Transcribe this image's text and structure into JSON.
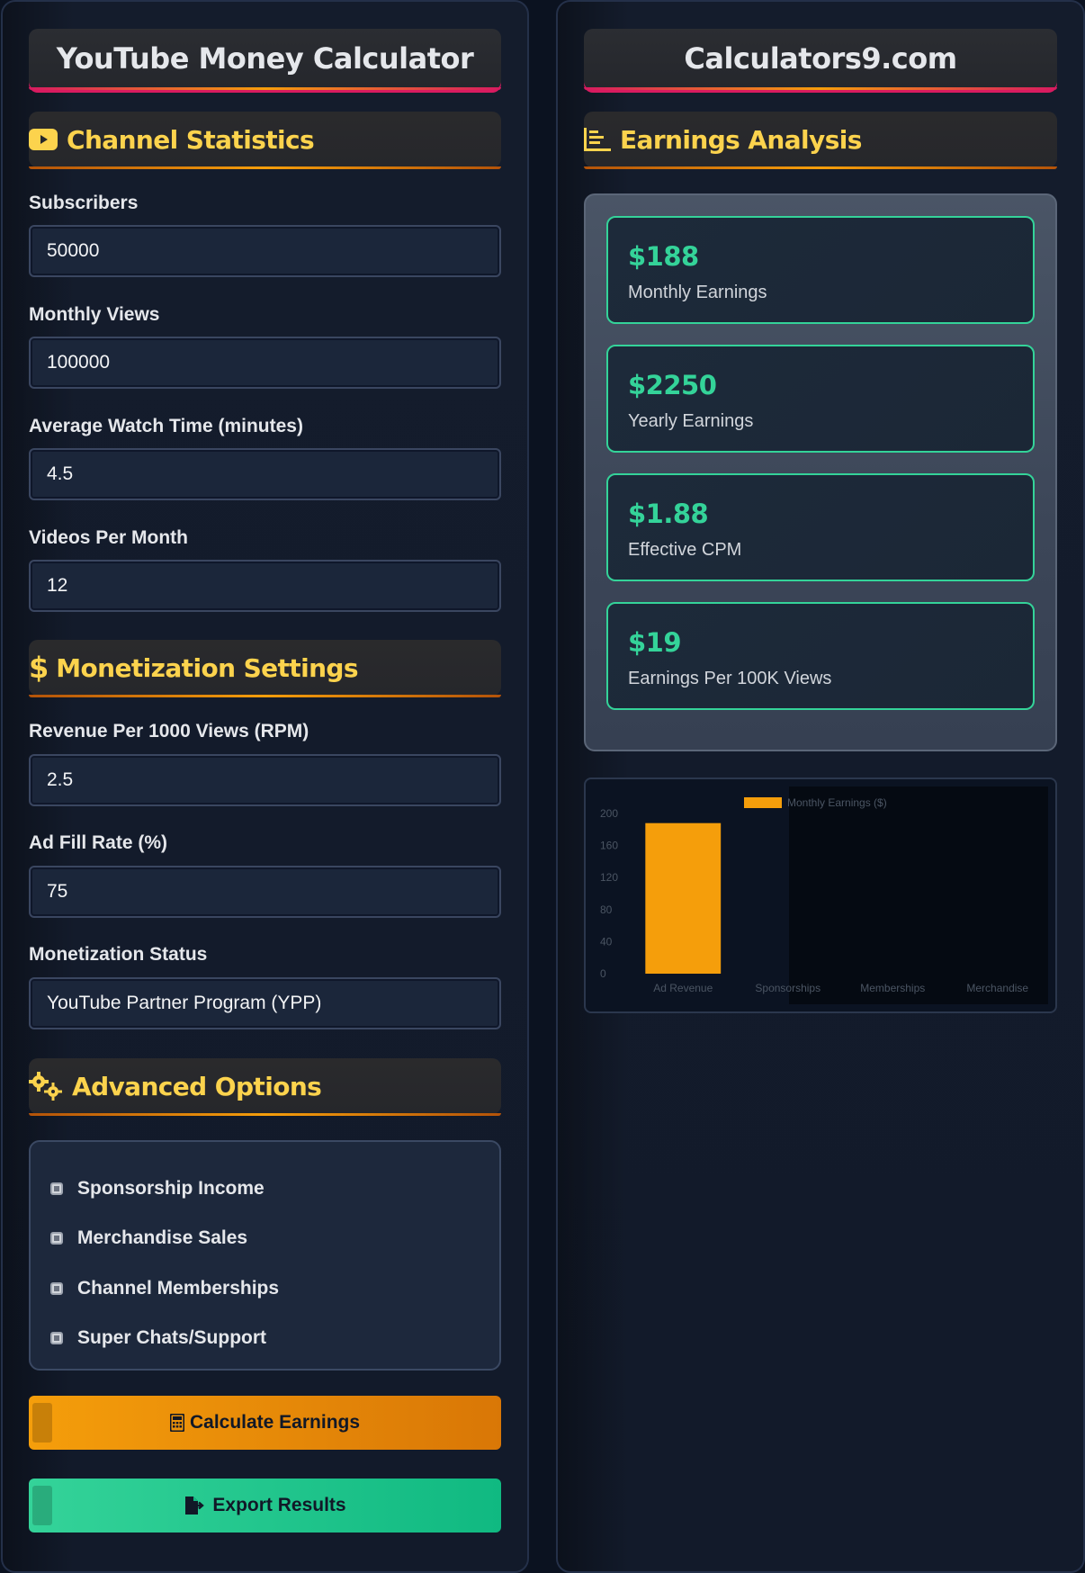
{
  "left_panel": {
    "title": "YouTube Money Calculator",
    "sections": {
      "channel": {
        "title": "Channel Statistics",
        "icon": "youtube-icon"
      },
      "monetization": {
        "title": "Monetization Settings",
        "icon": "dollar-icon"
      },
      "advanced": {
        "title": "Advanced Options",
        "icon": "gears-icon"
      }
    },
    "fields": {
      "subscribers": {
        "label": "Subscribers",
        "value": "50000"
      },
      "monthly_views": {
        "label": "Monthly Views",
        "value": "100000"
      },
      "watch_time": {
        "label": "Average Watch Time (minutes)",
        "value": "4.5"
      },
      "videos_per_month": {
        "label": "Videos Per Month",
        "value": "12"
      },
      "rpm": {
        "label": "Revenue Per 1000 Views (RPM)",
        "value": "2.5"
      },
      "fill_rate": {
        "label": "Ad Fill Rate (%)",
        "value": "75"
      },
      "status": {
        "label": "Monetization Status",
        "value": "YouTube Partner Program (YPP)"
      }
    },
    "options": [
      {
        "label": "Sponsorship Income",
        "checked": false
      },
      {
        "label": "Merchandise Sales",
        "checked": false
      },
      {
        "label": "Channel Memberships",
        "checked": false
      },
      {
        "label": "Super Chats/Support",
        "checked": false
      }
    ],
    "buttons": {
      "calculate": "Calculate Earnings",
      "export": "Export Results"
    },
    "colors": {
      "accent": "#f59e0b",
      "title": "#fcd34d",
      "success": "#34d399"
    }
  },
  "right_panel": {
    "title": "Calculators9.com",
    "section_title": "Earnings Analysis",
    "results": [
      {
        "value": "$188",
        "label": "Monthly Earnings"
      },
      {
        "value": "$2250",
        "label": "Yearly Earnings"
      },
      {
        "value": "$1.88",
        "label": "Effective CPM"
      },
      {
        "value": "$19",
        "label": "Earnings Per 100K Views"
      }
    ]
  },
  "chart_data": {
    "type": "bar",
    "categories": [
      "Ad Revenue",
      "Sponsorships",
      "Memberships",
      "Merchandise"
    ],
    "series": [
      {
        "name": "Monthly Earnings ($)",
        "values": [
          188,
          0,
          0,
          0
        ],
        "color": "#f59e0b"
      }
    ],
    "ylim": [
      0,
      200
    ],
    "yticks": [
      0,
      40,
      80,
      120,
      160,
      200
    ],
    "legend": "top-center"
  }
}
